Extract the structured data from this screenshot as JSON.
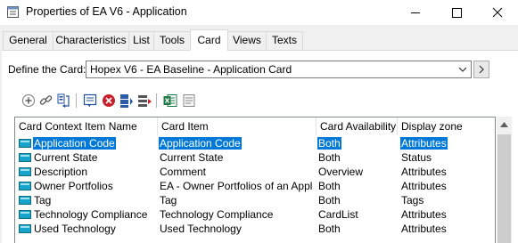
{
  "window": {
    "title": "Properties of EA V6 - Application"
  },
  "tabs": [
    {
      "label": "General"
    },
    {
      "label": "Characteristics"
    },
    {
      "label": "List"
    },
    {
      "label": "Tools"
    },
    {
      "label": "Card",
      "active": true
    },
    {
      "label": "Views"
    },
    {
      "label": "Texts"
    }
  ],
  "define": {
    "label": "Define the Card:",
    "value": "Hopex V6 - EA Baseline - Application Card"
  },
  "toolbar": {
    "icons": [
      "add-icon",
      "link-icon",
      "connect-icon",
      "properties-icon",
      "delete-icon",
      "reorder-icon",
      "export-excel-icon",
      "report-icon"
    ]
  },
  "table": {
    "headers": [
      "Card Context Item Name",
      "Card Item",
      "Card Availability",
      "Display zone"
    ],
    "rows": [
      [
        "Application Code",
        "Application Code",
        "Both",
        "Attributes"
      ],
      [
        "Current State",
        "Current State",
        "Both",
        "Status"
      ],
      [
        "Description",
        "Comment",
        "Overview",
        "Attributes"
      ],
      [
        "Owner Portfolios",
        "EA - Owner Portfolios of an Appli",
        "Both",
        "Attributes"
      ],
      [
        "Tag",
        "Tag",
        "Both",
        "Tags"
      ],
      [
        "Technology Compliance",
        "Technology Compliance",
        "CardList",
        "Attributes"
      ],
      [
        "Used Technology",
        "Used Technology",
        "Both",
        "Attributes"
      ]
    ],
    "selected_row": 0
  },
  "colors": {
    "selection": "#0078d7",
    "row_icon": "#19a5c9"
  }
}
